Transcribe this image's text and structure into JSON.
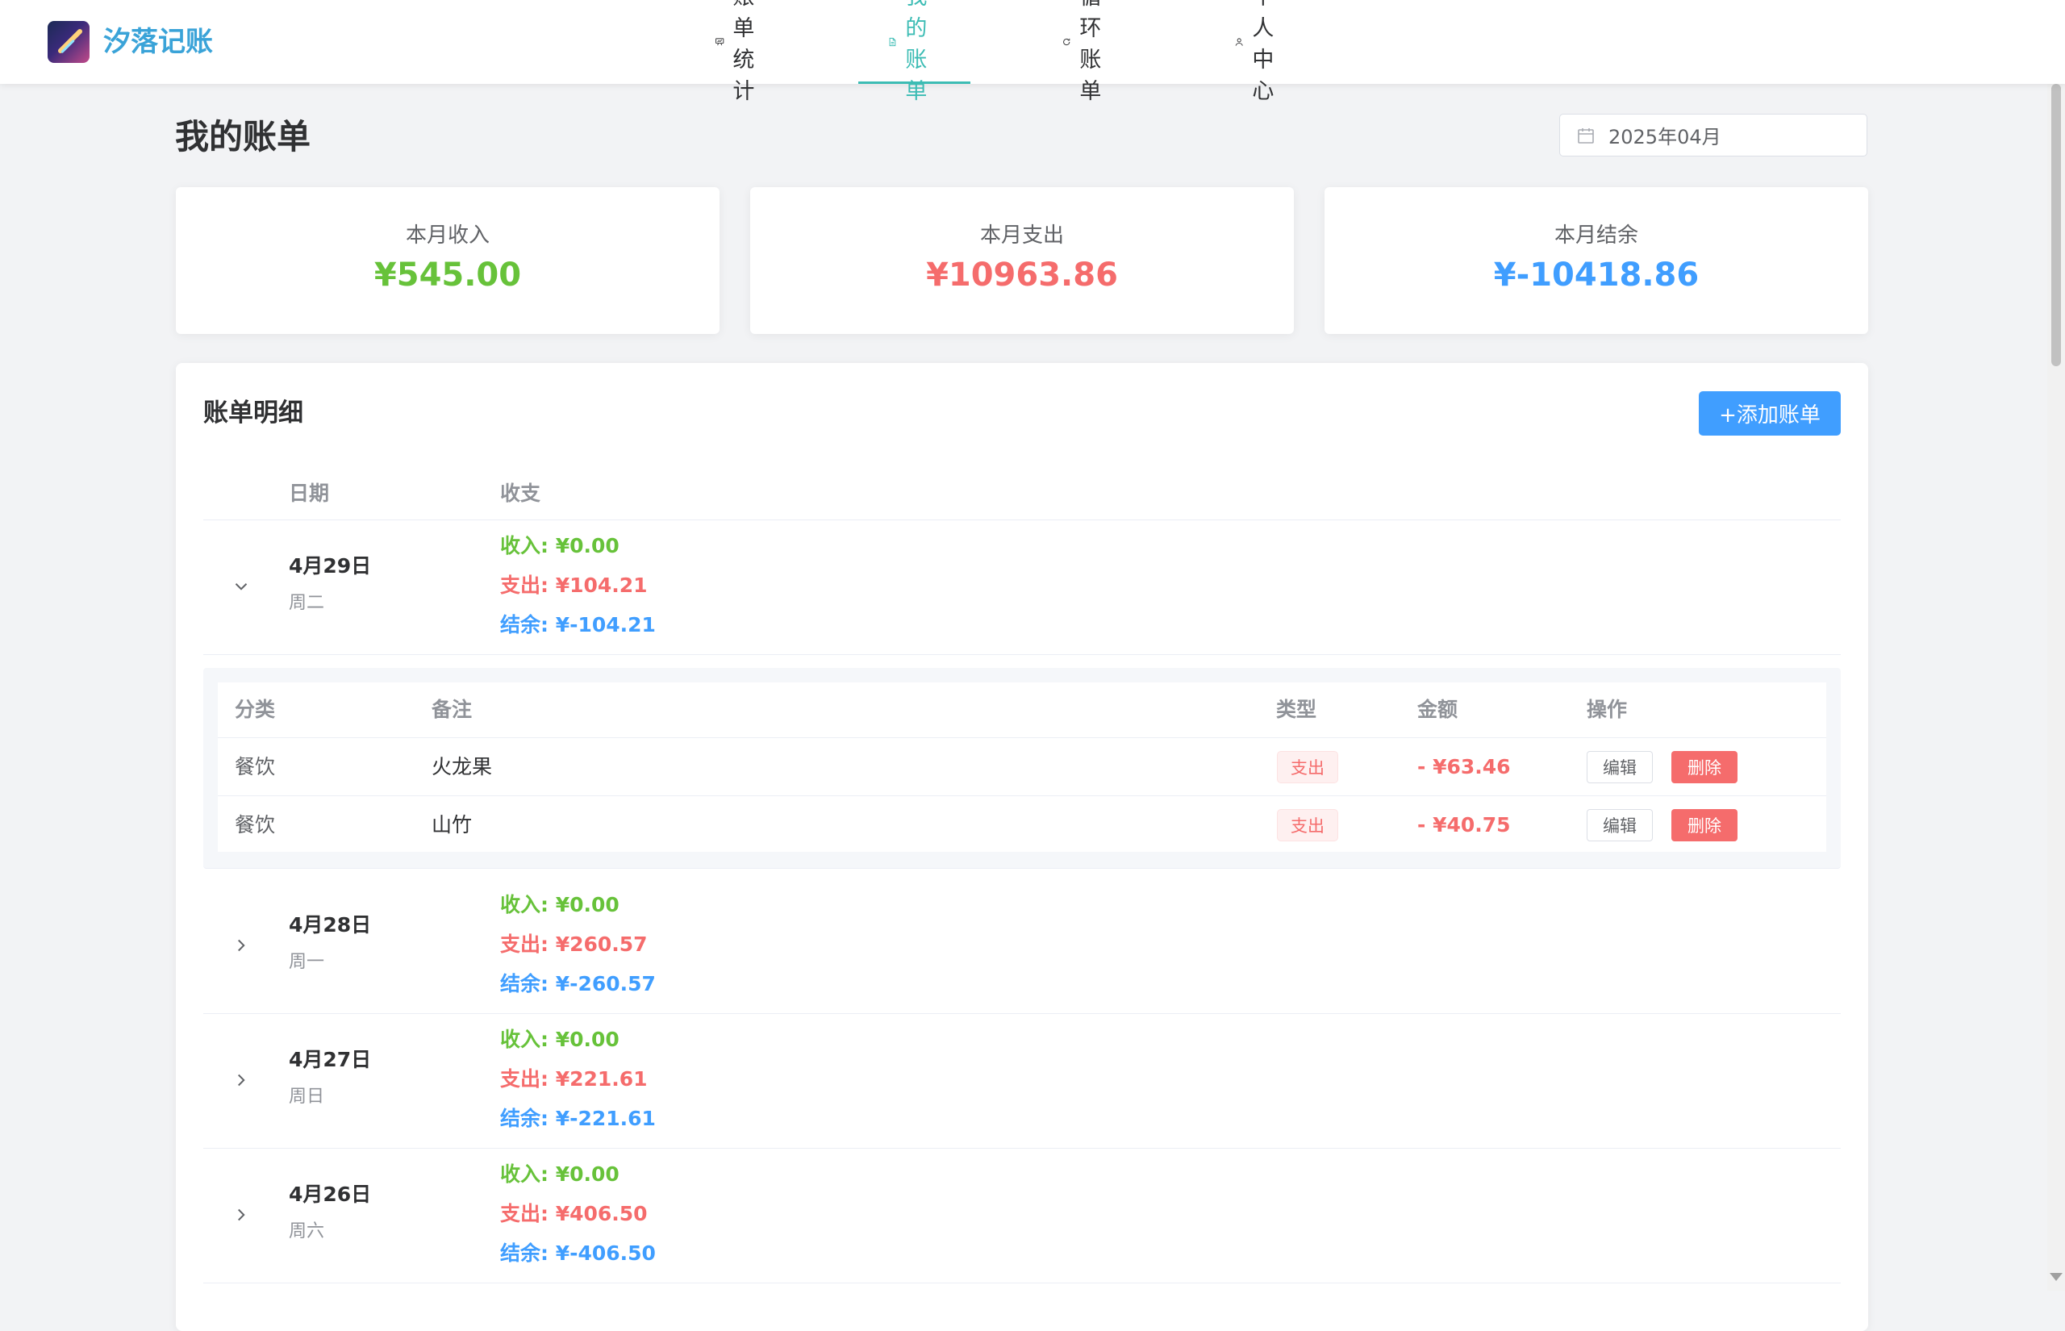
{
  "app": {
    "brand": "汐落记账"
  },
  "nav": {
    "items": [
      {
        "label": "账单统计",
        "icon": "presentation-chart-icon"
      },
      {
        "label": "我的账单",
        "icon": "document-icon",
        "active": true
      },
      {
        "label": "循环账单",
        "icon": "refresh-icon"
      },
      {
        "label": "个人中心",
        "icon": "user-icon"
      }
    ]
  },
  "page": {
    "title": "我的账单",
    "month_value": "2025年04月"
  },
  "summary": {
    "income": {
      "label": "本月收入",
      "value": "¥545.00",
      "color": "#67c23a"
    },
    "expense": {
      "label": "本月支出",
      "value": "¥10963.86",
      "color": "#f56c6c"
    },
    "balance": {
      "label": "本月结余",
      "value": "¥-10418.86",
      "color": "#409eff"
    }
  },
  "detail": {
    "title": "账单明细",
    "add_button": "+添加账单",
    "columns": {
      "date": "日期",
      "flow": "收支"
    },
    "days": [
      {
        "date": "4月29日",
        "weekday": "周二",
        "income": "收入: ¥0.00",
        "expense": "支出: ¥104.21",
        "balance": "结余: ¥-104.21",
        "expanded": true
      },
      {
        "date": "4月28日",
        "weekday": "周一",
        "income": "收入: ¥0.00",
        "expense": "支出: ¥260.57",
        "balance": "结余: ¥-260.57"
      },
      {
        "date": "4月27日",
        "weekday": "周日",
        "income": "收入: ¥0.00",
        "expense": "支出: ¥221.61",
        "balance": "结余: ¥-221.61"
      },
      {
        "date": "4月26日",
        "weekday": "周六",
        "income": "收入: ¥0.00",
        "expense": "支出: ¥406.50",
        "balance": "结余: ¥-406.50"
      }
    ],
    "inner_columns": {
      "category": "分类",
      "note": "备注",
      "type": "类型",
      "amount": "金额",
      "actions": "操作"
    },
    "entries": [
      {
        "category": "餐饮",
        "note": "火龙果",
        "type": "支出",
        "amount": "- ¥63.46",
        "edit": "编辑",
        "delete": "删除"
      },
      {
        "category": "餐饮",
        "note": "山竹",
        "type": "支出",
        "amount": "- ¥40.75",
        "edit": "编辑",
        "delete": "删除"
      }
    ]
  },
  "colors": {
    "accent": "#3cbcb4",
    "primary": "#409eff",
    "income": "#67c23a",
    "expense": "#f56c6c"
  }
}
